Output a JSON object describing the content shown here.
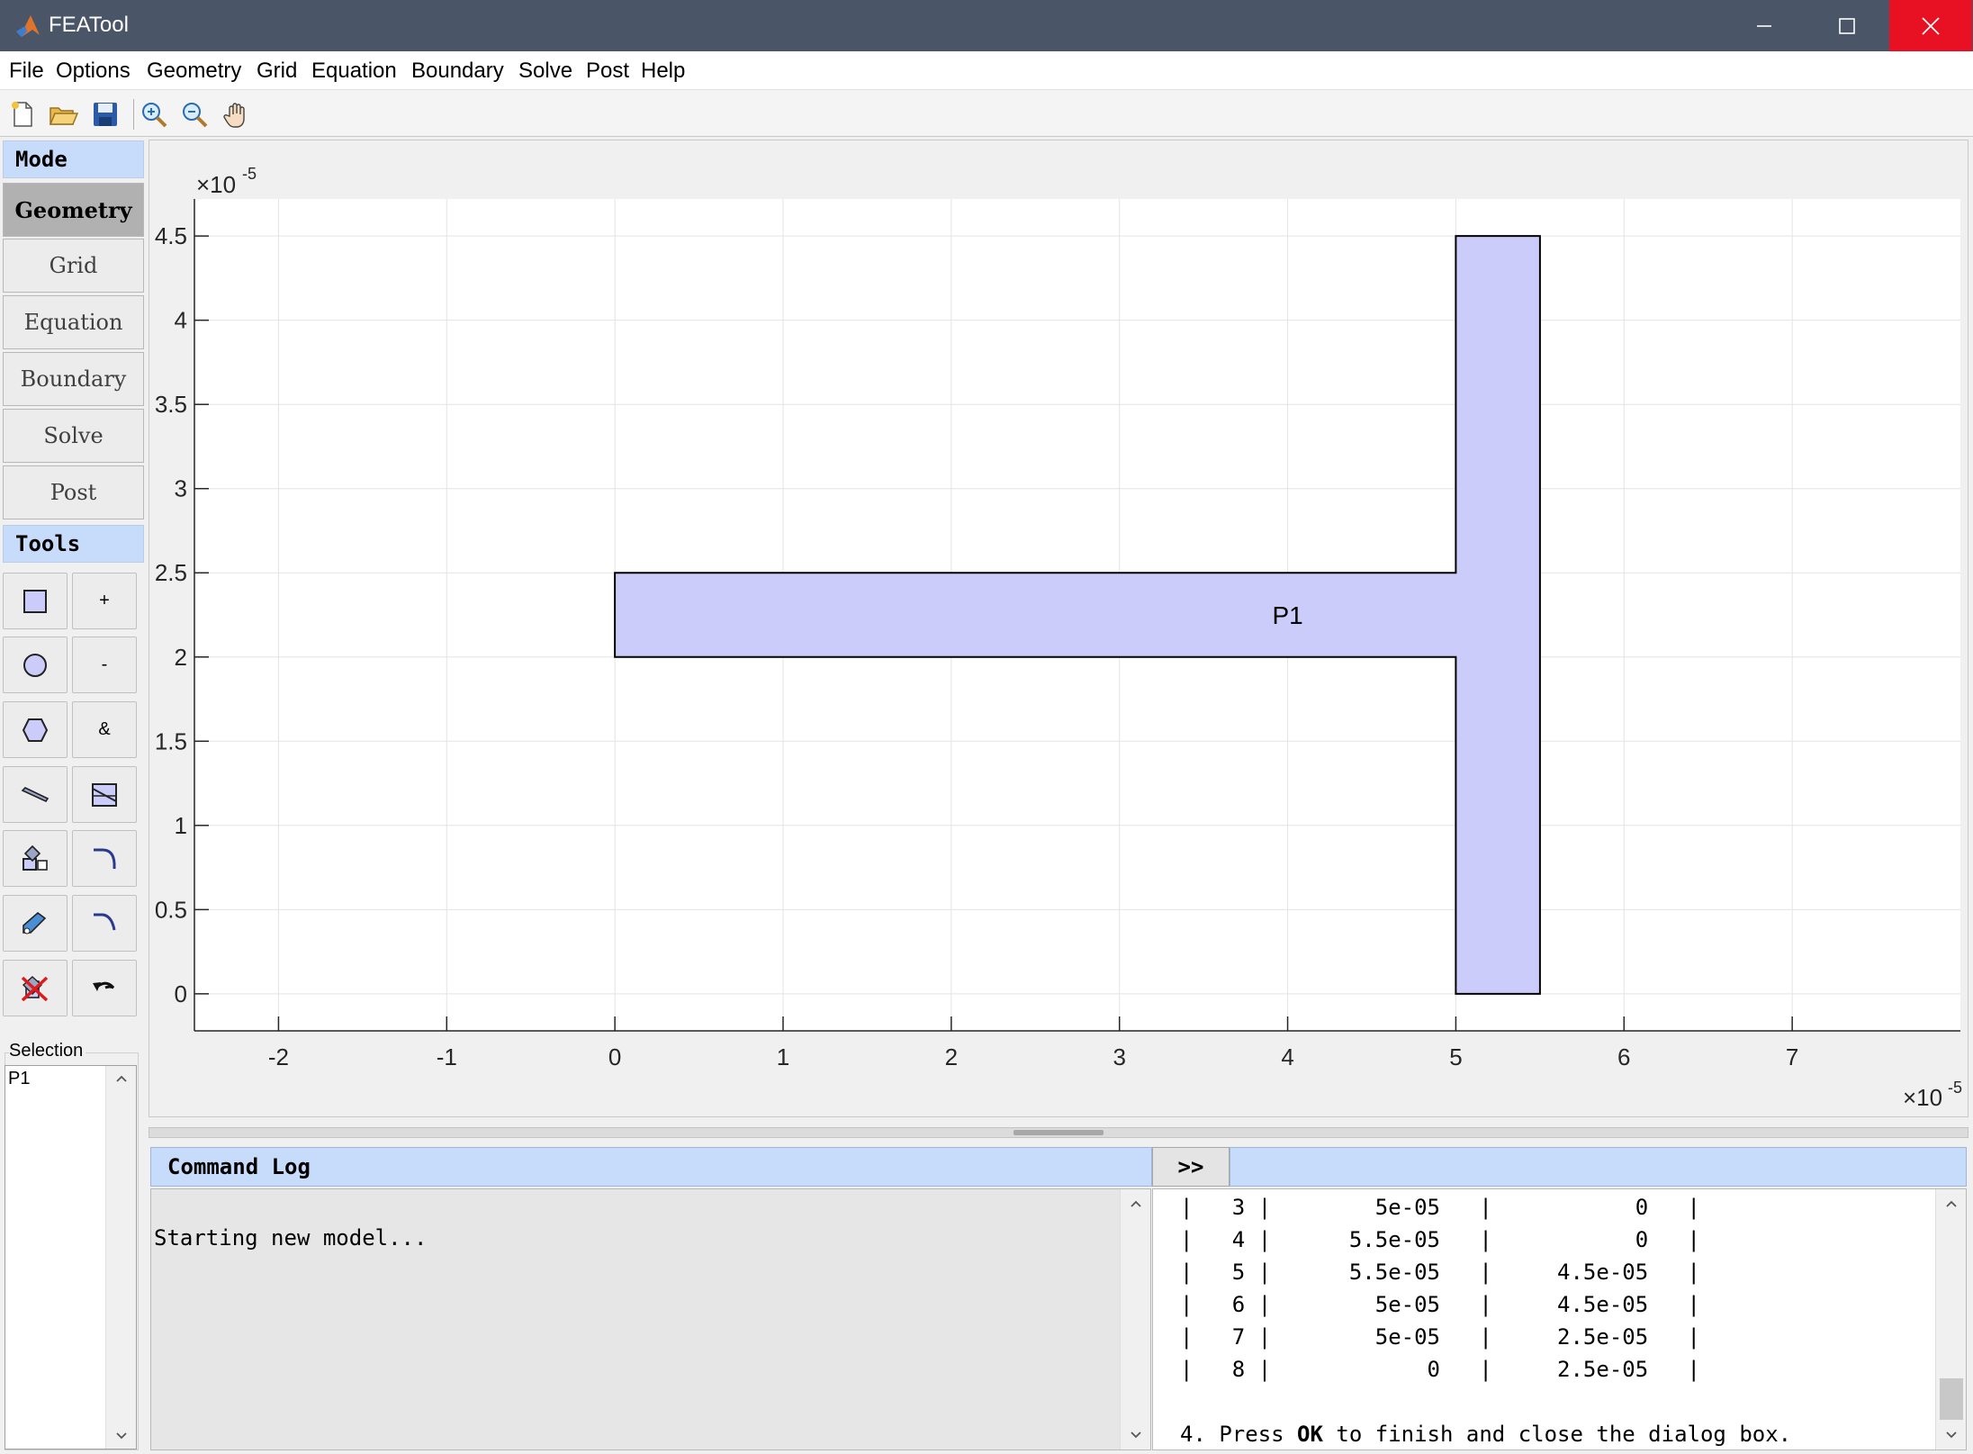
{
  "window": {
    "title": "FEATool"
  },
  "menu": [
    "File",
    "Options",
    "Geometry",
    "Grid",
    "Equation",
    "Boundary",
    "Solve",
    "Post",
    "Help"
  ],
  "toolbar": {
    "buttons": [
      "new-file-icon",
      "open-folder-icon",
      "save-icon",
      "zoom-in-icon",
      "zoom-out-icon",
      "pan-hand-icon"
    ]
  },
  "mode_panel": {
    "header": "Mode",
    "modes": [
      "Geometry",
      "Grid",
      "Equation",
      "Boundary",
      "Solve",
      "Post"
    ],
    "active": "Geometry"
  },
  "tools_panel": {
    "header": "Tools",
    "buttons": [
      {
        "icon": "rectangle-icon"
      },
      {
        "label": "+"
      },
      {
        "icon": "circle-icon"
      },
      {
        "label": "-"
      },
      {
        "icon": "polygon-icon"
      },
      {
        "label": "&"
      },
      {
        "icon": "line-icon"
      },
      {
        "icon": "split-icon"
      },
      {
        "icon": "transform-icon"
      },
      {
        "icon": "fillet-icon"
      },
      {
        "icon": "edit-object-icon"
      },
      {
        "icon": "chamfer-icon"
      },
      {
        "icon": "delete-icon"
      },
      {
        "icon": "undo-icon"
      }
    ]
  },
  "selection": {
    "label": "Selection",
    "items": [
      "P1"
    ]
  },
  "plot": {
    "x_exponent_base": "×10",
    "x_exponent_power": "-5",
    "y_exponent_base": "×10",
    "y_exponent_power": "-5",
    "x_ticks": [
      -2,
      -1,
      0,
      1,
      2,
      3,
      4,
      5,
      6,
      7
    ],
    "y_ticks": [
      0,
      0.5,
      1,
      1.5,
      2,
      2.5,
      3,
      3.5,
      4,
      4.5
    ],
    "x_range": [
      -2.5,
      8
    ],
    "y_range": [
      -0.22,
      4.72
    ],
    "grid": true,
    "geometry": {
      "name": "P1",
      "fill_color": "#ccccfa",
      "edge_color": "#000000",
      "vertices": [
        [
          0,
          2
        ],
        [
          5,
          2
        ],
        [
          5,
          0
        ],
        [
          5.5,
          0
        ],
        [
          5.5,
          4.5
        ],
        [
          5,
          4.5
        ],
        [
          5,
          2.5
        ],
        [
          0,
          2.5
        ]
      ],
      "label_position": [
        4,
        2.25
      ]
    }
  },
  "command_log": {
    "header": "Command Log",
    "toggle_label": ">>",
    "text": "Starting new model..."
  },
  "help": {
    "lines": [
      "|   3 |        5e-05   |           0   |",
      "|   4 |      5.5e-05   |           0   |",
      "|   5 |      5.5e-05   |     4.5e-05   |",
      "|   6 |        5e-05   |     4.5e-05   |",
      "|   7 |        5e-05   |     2.5e-05   |",
      "|   8 |            0   |     2.5e-05   |",
      "",
      "4. Press ",
      "OK",
      " to finish and close the dialog box."
    ]
  },
  "colors": {
    "titlebar": "#4a5667",
    "close_button": "#e81123",
    "header_blue": "#c7dcfb",
    "active_mode": "#b1b1b1",
    "geometry_fill": "#ccccfa"
  }
}
